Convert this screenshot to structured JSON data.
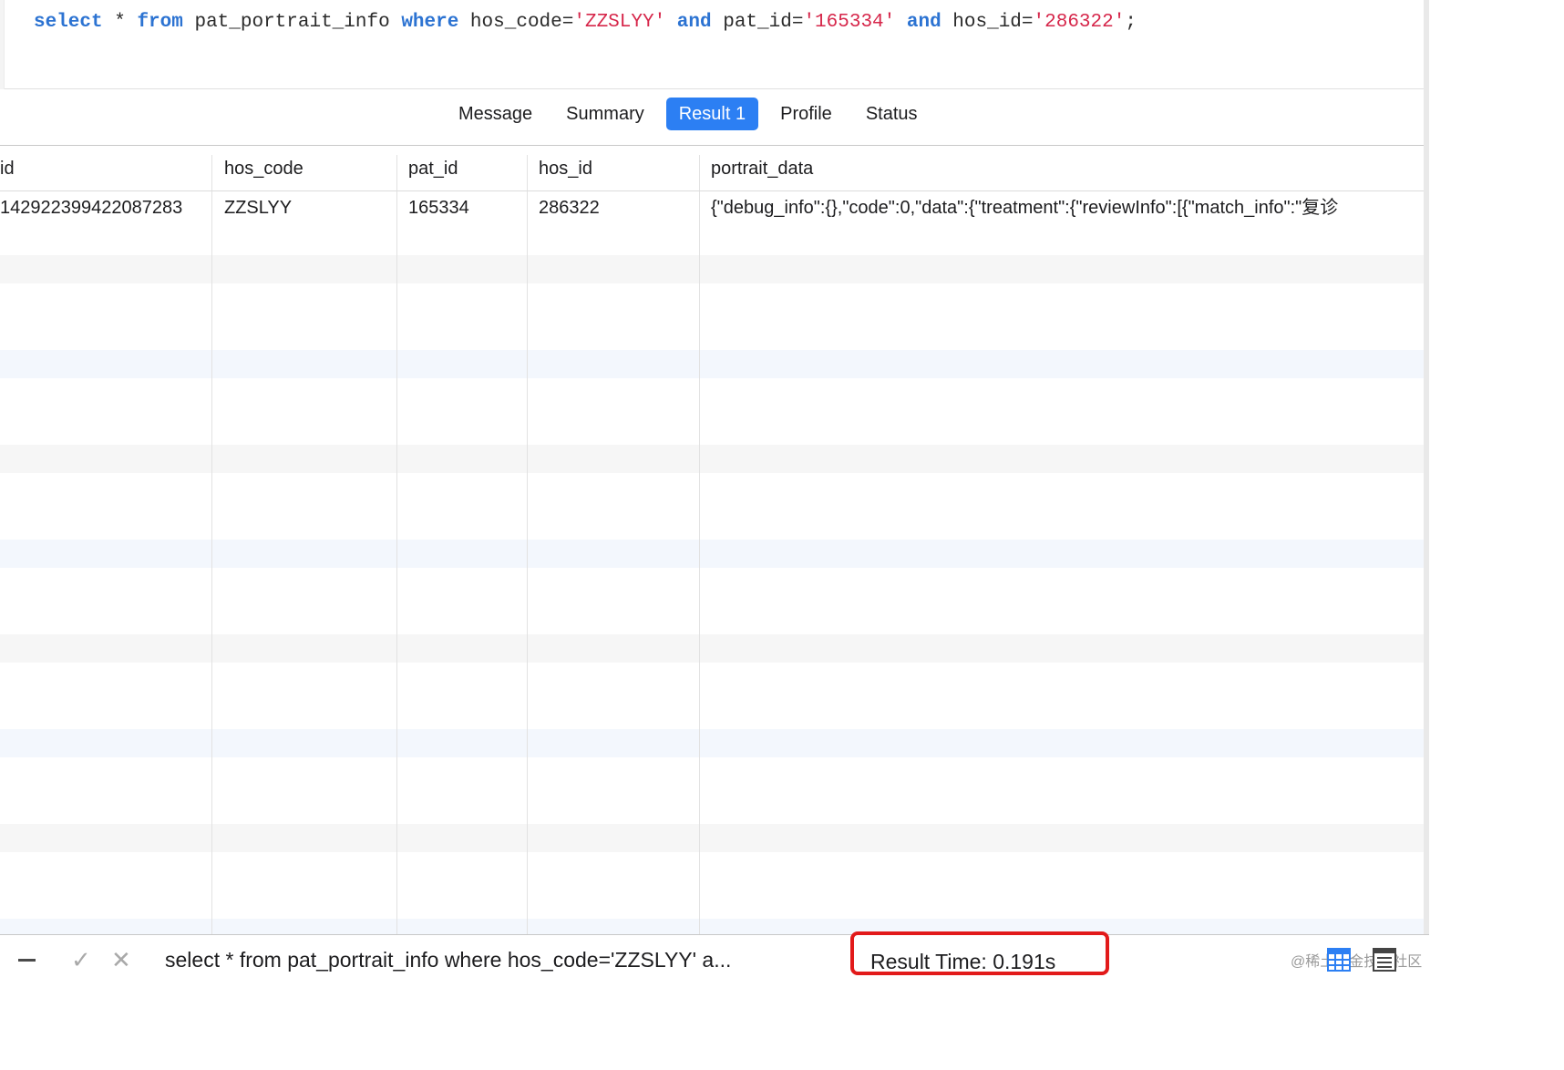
{
  "editor": {
    "sql_tokens": [
      {
        "t": "select",
        "k": "kw"
      },
      {
        "t": " * ",
        "k": "txt"
      },
      {
        "t": "from",
        "k": "kw"
      },
      {
        "t": " pat_portrait_info ",
        "k": "txt"
      },
      {
        "t": "where",
        "k": "kw"
      },
      {
        "t": " hos_code=",
        "k": "txt"
      },
      {
        "t": "'ZZSLYY'",
        "k": "str"
      },
      {
        "t": " ",
        "k": "txt"
      },
      {
        "t": "and",
        "k": "kw"
      },
      {
        "t": " pat_id=",
        "k": "txt"
      },
      {
        "t": "'165334'",
        "k": "str"
      },
      {
        "t": " ",
        "k": "txt"
      },
      {
        "t": "and",
        "k": "kw"
      },
      {
        "t": " hos_id=",
        "k": "txt"
      },
      {
        "t": "'286322'",
        "k": "str"
      },
      {
        "t": ";",
        "k": "txt"
      }
    ]
  },
  "tabs": [
    {
      "label": "Message",
      "active": false
    },
    {
      "label": "Summary",
      "active": false
    },
    {
      "label": "Result 1",
      "active": true
    },
    {
      "label": "Profile",
      "active": false
    },
    {
      "label": "Status",
      "active": false
    }
  ],
  "grid": {
    "columns": [
      "id",
      "hos_code",
      "pat_id",
      "hos_id",
      "portrait_data"
    ],
    "rows": [
      [
        "142922399422087283",
        "ZZSLYY",
        "165334",
        "286322",
        "{\"debug_info\":{},\"code\":0,\"data\":{\"treatment\":{\"reviewInfo\":[{\"match_info\":\"复诊"
      ]
    ]
  },
  "statusbar": {
    "query_preview": "select * from pat_portrait_info where hos_code='ZZSLYY' a...",
    "result_time": "Result Time: 0.191s",
    "watermark": "@稀土掘金技术社区",
    "check_glyph": "✓",
    "cross_glyph": "✕"
  },
  "colors": {
    "keyword": "#2c73d2",
    "string": "#d6264a",
    "tab_active": "#2c7ff3",
    "highlight_box": "#e21a1a"
  }
}
